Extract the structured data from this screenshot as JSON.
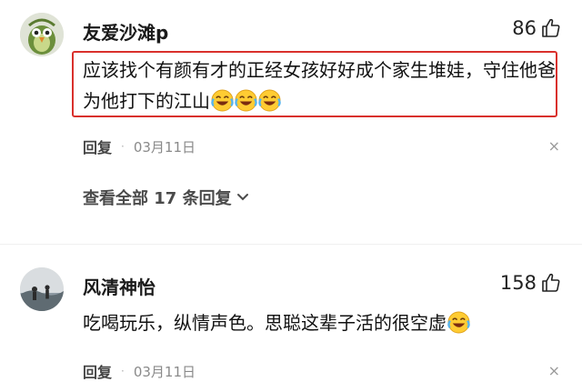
{
  "comments": [
    {
      "username": "友爱沙滩p",
      "likes": "86",
      "text": "应该找个有颜有才的正经女孩好好成个家生堆娃，守住他爸为他打下的江山",
      "emoji_count": 3,
      "reply_label": "回复",
      "date": "03月11日",
      "view_all_label": "查看全部 17 条回复"
    },
    {
      "username": "风清神怡",
      "likes": "158",
      "text": "吃喝玩乐，纵情声色。思聪这辈子活的很空虚",
      "emoji_count": 1,
      "reply_label": "回复",
      "date": "03月11日"
    }
  ],
  "icons": {
    "like": "thumbs-up-icon",
    "laugh": "laughing-crying-emoji",
    "close": "close-icon",
    "chevron": "chevron-down-icon"
  },
  "colors": {
    "highlight_border": "#d9302c",
    "meta_gray": "#8a8a8a"
  },
  "separator": "·",
  "close_glyph": "×"
}
